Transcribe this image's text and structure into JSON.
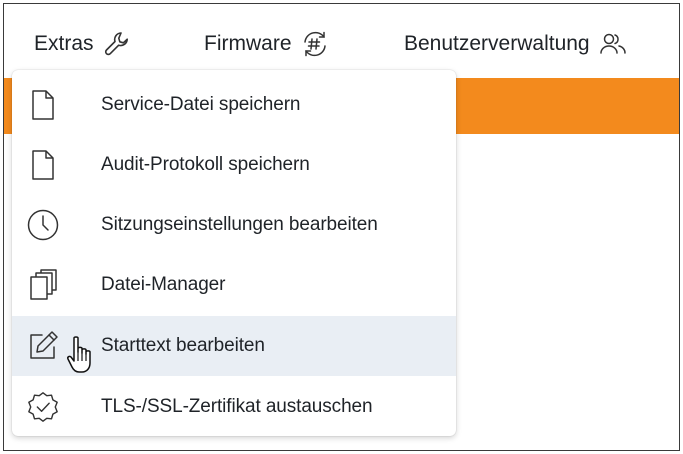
{
  "menubar": {
    "items": [
      {
        "label": "Extras",
        "icon": "wrench-icon"
      },
      {
        "label": "Firmware",
        "icon": "firmware-update-icon"
      },
      {
        "label": "Benutzerverwaltung",
        "icon": "users-icon"
      }
    ]
  },
  "dropdown": {
    "items": [
      {
        "label": "Service-Datei speichern",
        "icon": "file-icon"
      },
      {
        "label": "Audit-Protokoll speichern",
        "icon": "file-icon"
      },
      {
        "label": "Sitzungseinstellungen bearbeiten",
        "icon": "clock-icon"
      },
      {
        "label": "Datei-Manager",
        "icon": "files-stack-icon"
      },
      {
        "label": "Starttext bearbeiten",
        "icon": "edit-icon",
        "hovered": true
      },
      {
        "label": "TLS-/SSL-Zertifikat austauschen",
        "icon": "certificate-badge-icon"
      }
    ]
  },
  "colors": {
    "accent": "#f38a1d",
    "hover": "#e9eef4",
    "text": "#1f2328"
  }
}
